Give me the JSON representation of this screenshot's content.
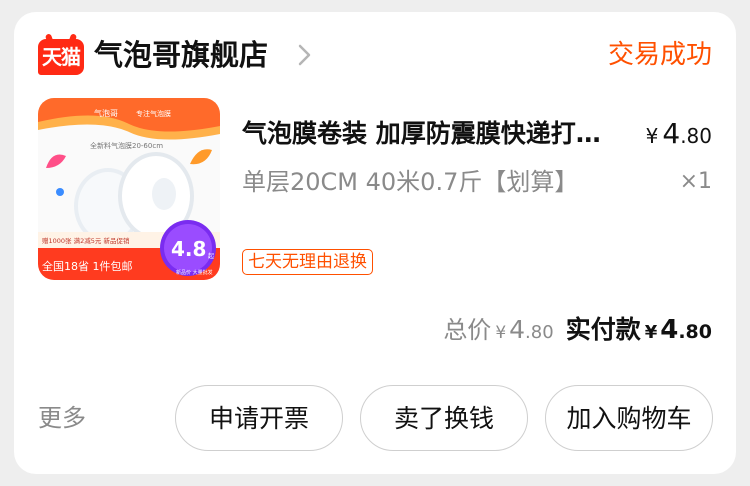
{
  "header": {
    "badge": "天猫",
    "shop_name": "气泡哥旗舰店",
    "status": "交易成功"
  },
  "product": {
    "title": "气泡膜卷装 加厚防震膜快递打包泡沫纸",
    "spec": "单层20CM 40米0.7斤【划算】",
    "price": {
      "symbol": "¥",
      "int": "4",
      "dec": ".80"
    },
    "quantity": "×1",
    "tag": "七天无理由退换",
    "image": {
      "brand": "气泡哥",
      "slogan": "专注气泡膜",
      "sub": "全新料气泡膜20-60cm",
      "banner": "全国18省 1件包邮",
      "strip": "赠1000张 满2减5元 新品促销",
      "price_big": "4.8",
      "price_unit": "起",
      "side_note": "新品价 大量批发"
    }
  },
  "totals": {
    "total_label": "总价",
    "total": {
      "symbol": "¥",
      "int": "4",
      "dec": ".80"
    },
    "paid_label": "实付款",
    "paid": {
      "symbol": "¥",
      "int": "4",
      "dec": ".80"
    }
  },
  "footer": {
    "more": "更多",
    "invoice_button": "申请开票",
    "resell_button": "卖了换钱",
    "cart_button": "加入购物车"
  },
  "colors": {
    "accent": "#ff5000",
    "tmall_red": "#ff2a14",
    "text": "#111111",
    "muted": "#8a8a8a"
  }
}
